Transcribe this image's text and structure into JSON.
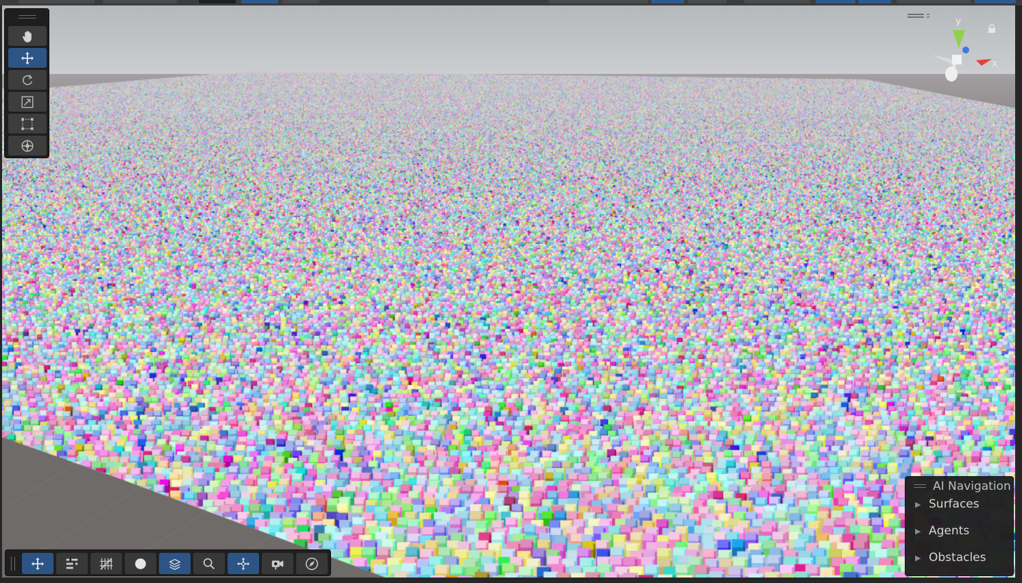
{
  "scene_tools": [
    {
      "id": "hand",
      "name": "hand-tool-button",
      "icon": "hand-icon",
      "active": false
    },
    {
      "id": "move",
      "name": "move-tool-button",
      "icon": "move-arrows-icon",
      "active": true
    },
    {
      "id": "rotate",
      "name": "rotate-tool-button",
      "icon": "rotate-icon",
      "active": false
    },
    {
      "id": "scale",
      "name": "scale-tool-button",
      "icon": "scale-icon",
      "active": false
    },
    {
      "id": "rect",
      "name": "rect-tool-button",
      "icon": "rect-transform-icon",
      "active": false
    },
    {
      "id": "transform",
      "name": "transform-tool-button",
      "icon": "transform-icon",
      "active": false
    }
  ],
  "orientation_gizmo": {
    "y_label": "y",
    "x_label": "x",
    "colors": {
      "y": "#7dcc3a",
      "x": "#e0443a",
      "z": "#3b7be0"
    }
  },
  "ai_navigation": {
    "title": "AI Navigation",
    "items": [
      {
        "label": "Surfaces"
      },
      {
        "label": "Agents"
      },
      {
        "label": "Obstacles"
      }
    ]
  },
  "bottom_toolbar": [
    {
      "name": "move-view-button",
      "icon": "move-arrows-icon",
      "active": true
    },
    {
      "name": "overlay-menu-button",
      "icon": "overlay-menu-icon",
      "active": false
    },
    {
      "name": "grid-toggle-button",
      "icon": "grid-icon",
      "active": false
    },
    {
      "name": "shading-mode-button",
      "icon": "sphere-shading-icon",
      "active": false
    },
    {
      "name": "layers-button",
      "icon": "layers-icon",
      "active": true
    },
    {
      "name": "search-button",
      "icon": "search-icon",
      "active": false
    },
    {
      "name": "pivot-button",
      "icon": "pivot-icon",
      "active": true
    },
    {
      "name": "camera-button",
      "icon": "camera-icon",
      "active": false
    },
    {
      "name": "compass-button",
      "icon": "compass-icon",
      "active": false
    }
  ],
  "colors": {
    "accent": "#2c5485",
    "panel": "#1e1e1e",
    "ground": "#6e6a68"
  }
}
